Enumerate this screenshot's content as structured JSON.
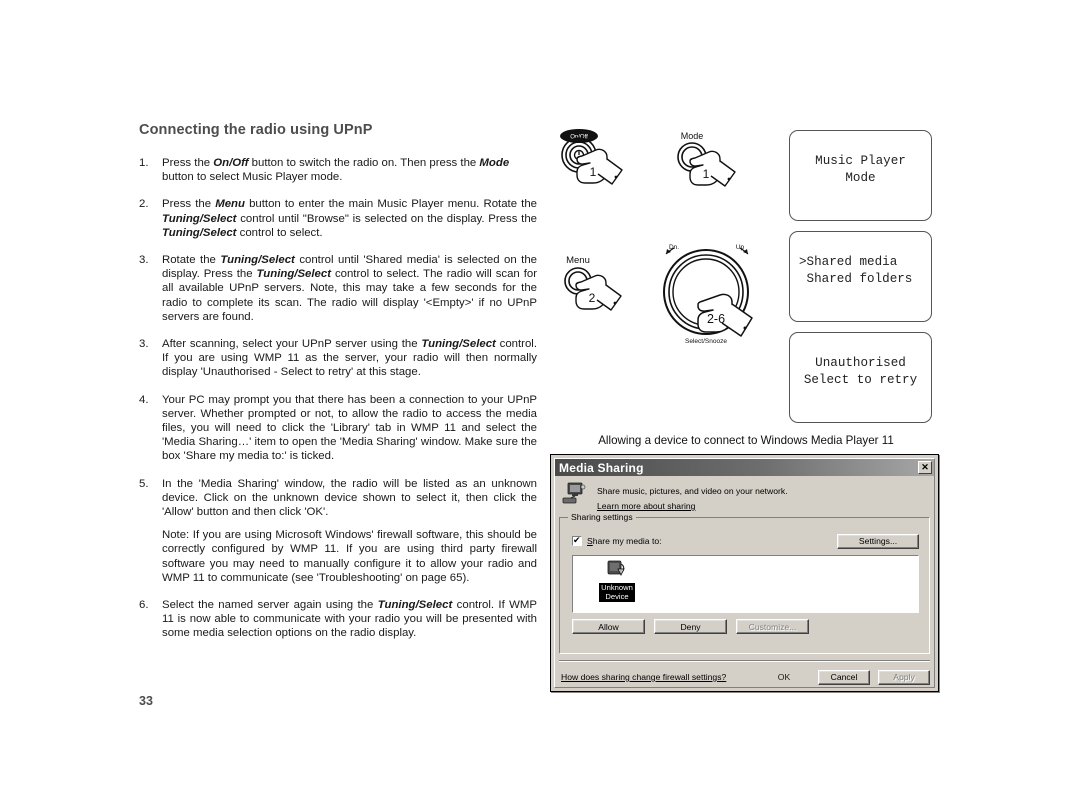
{
  "page": {
    "title": "Connecting the radio using UPnP",
    "number": "33"
  },
  "steps": [
    {
      "num": "1.",
      "parts": [
        {
          "t": "Press the ",
          "b": false
        },
        {
          "t": "On/Off",
          "b": true
        },
        {
          "t": " button to switch the radio on. Then press the ",
          "b": false
        },
        {
          "t": "Mode",
          "b": true
        },
        {
          "t": " button to select Music Player mode.",
          "b": false
        }
      ]
    },
    {
      "num": "2.",
      "parts": [
        {
          "t": "Press the ",
          "b": false
        },
        {
          "t": "Menu",
          "b": true
        },
        {
          "t": " button to enter the main Music Player menu. Rotate the ",
          "b": false
        },
        {
          "t": "Tuning/Select",
          "b": true
        },
        {
          "t": " control until \"Browse\" is selected on the display. Press the ",
          "b": false
        },
        {
          "t": "Tuning/Select",
          "b": true
        },
        {
          "t": " control to select.",
          "b": false
        }
      ]
    },
    {
      "num": "3.",
      "parts": [
        {
          "t": "Rotate the ",
          "b": false
        },
        {
          "t": "Tuning/Select",
          "b": true
        },
        {
          "t": " control until 'Shared media' is selected on the display. Press the ",
          "b": false
        },
        {
          "t": "Tuning/Select",
          "b": true
        },
        {
          "t": " control to select. The radio will scan for all available UPnP servers. Note, this may take a few seconds for the radio to complete its scan. The radio will display '<Empty>' if no UPnP servers are found.",
          "b": false
        }
      ]
    },
    {
      "num": "3.",
      "parts": [
        {
          "t": "After scanning, select your UPnP server using the ",
          "b": false
        },
        {
          "t": "Tuning/Select",
          "b": true
        },
        {
          "t": " control. If you are using WMP 11 as the server, your radio will then normally display 'Unauthorised - Select to retry' at this stage.",
          "b": false
        }
      ]
    },
    {
      "num": "4.",
      "parts": [
        {
          "t": "Your PC may prompt you that there has been a connection to your UPnP server. Whether prompted or not, to allow the radio to  access the media files, you will need to click the 'Library' tab in WMP 11 and select the 'Media Sharing…' item to open the 'Media Sharing' window. Make sure the box 'Share my media to:' is ticked.",
          "b": false
        }
      ]
    },
    {
      "num": "5.",
      "parts": [
        {
          "t": "In the 'Media Sharing' window, the radio will be listed as an unknown device. Click on the unknown device shown to select it, then click the 'Allow' button and then click 'OK'.",
          "b": false
        }
      ],
      "note": "Note: If you are using Microsoft Windows' firewall software, this should be correctly configured by WMP 11. If you are using third party firewall software you may need to manually configure it to allow your radio and WMP 11 to communicate (see 'Troubleshooting' on page 65)."
    },
    {
      "num": "6.",
      "parts": [
        {
          "t": "Select the named server again using the ",
          "b": false
        },
        {
          "t": "Tuning/Select",
          "b": true
        },
        {
          "t": " control. If WMP 11 is now able to communicate with your radio you will be presented with some media selection options on the radio display.",
          "b": false
        }
      ]
    }
  ],
  "illustrations": {
    "onoff_label": "On/Off",
    "onoff_step": "1",
    "mode_label": "Mode",
    "mode_step": "1",
    "menu_label": "Menu",
    "menu_step": "2",
    "knob_down_label": "Dn.",
    "knob_up_label": "Up",
    "knob_select_label": "Select/Snooze",
    "knob_step": "2-6"
  },
  "lcd_screens": [
    {
      "lines": [
        "Music Player",
        "Mode"
      ],
      "align": "center"
    },
    {
      "lines": [
        ">Shared media",
        " Shared folders"
      ],
      "align": "left"
    },
    {
      "lines": [
        "Unauthorised",
        "Select to retry"
      ],
      "align": "center"
    }
  ],
  "caption": "Allowing a device to connect to Windows Media Player 11",
  "dialog": {
    "title": "Media Sharing",
    "close_label": "✕",
    "header_text": "Share music, pictures, and video on your network.",
    "header_link": "Learn more about sharing",
    "group_legend": "Sharing settings",
    "checkbox_label_pre": "S",
    "checkbox_label_post": "hare my media to:",
    "settings_button": "Settings...",
    "device_name_line1": "Unknown",
    "device_name_line2": "Device",
    "allow_button": "Allow",
    "deny_button": "Deny",
    "customize_button": "Customize...",
    "footer_link": "How does sharing change firewall settings?",
    "ok_button": "OK",
    "cancel_button": "Cancel",
    "apply_button": "Apply"
  }
}
